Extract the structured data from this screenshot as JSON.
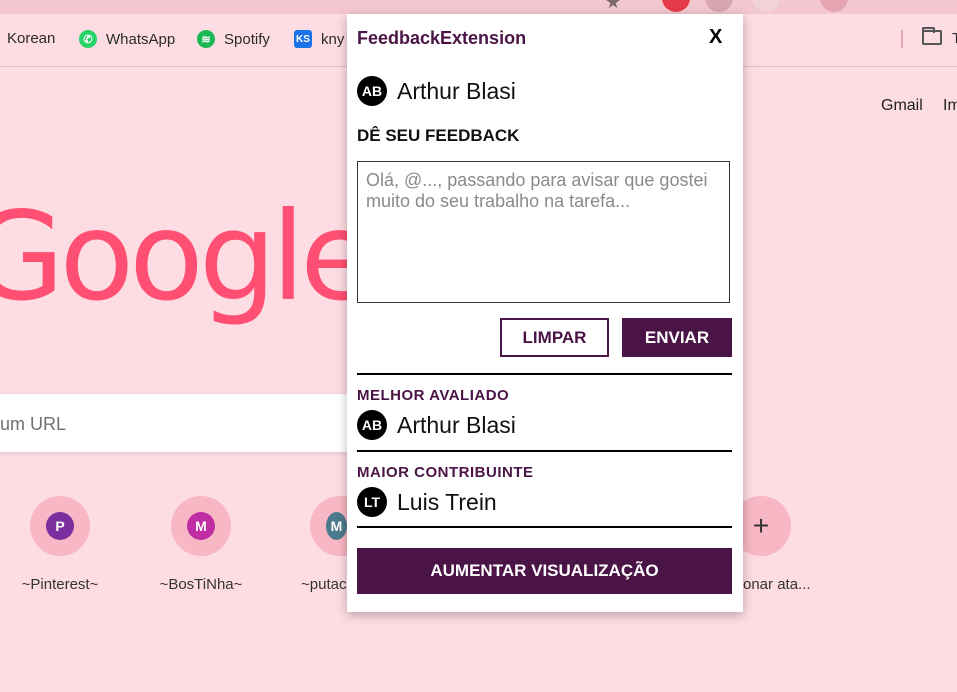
{
  "bookmarks": [
    {
      "label": "Korean",
      "icon": "korean-bookmark-icon"
    },
    {
      "label": "WhatsApp",
      "icon": "whatsapp-icon",
      "color": "#25d366"
    },
    {
      "label": "Spotify",
      "icon": "spotify-icon",
      "color": "#1db954"
    },
    {
      "label": "kny",
      "icon": "ks-icon",
      "color": "#1a73e8"
    }
  ],
  "bookmarks_right": {
    "folder_icon": "folder-icon",
    "truncated_label": "T"
  },
  "ntp": {
    "gmail_link": "Gmail",
    "images_link": "Im",
    "logo_text": "Google",
    "search_placeholder": "um URL",
    "shortcuts": [
      {
        "label": "~Pinterest~",
        "letter": "P",
        "color": "#7b2e9e"
      },
      {
        "label": "~BosTiNha~",
        "letter": "M",
        "color": "#c02ca2"
      },
      {
        "label": "~putac",
        "letter": "M",
        "color": "#4d7a8c"
      }
    ],
    "add_shortcut_label": "onar ata..."
  },
  "popup": {
    "title": "FeedbackExtension",
    "close_label": "X",
    "current_user": {
      "initials": "AB",
      "name": "Arthur Blasi"
    },
    "feedback_section_title": "DÊ SEU FEEDBACK",
    "feedback_placeholder": "Olá, @..., passando para avisar que gostei muito do seu trabalho na tarefa...",
    "clear_button": "LIMPAR",
    "send_button": "ENVIAR",
    "best_rated": {
      "title": "MELHOR AVALIADO",
      "initials": "AB",
      "name": "Arthur Blasi"
    },
    "top_contributor": {
      "title": "MAIOR CONTRIBUINTE",
      "initials": "LT",
      "name": "Luis Trein"
    },
    "expand_button": "AUMENTAR VISUALIZAÇÃO"
  },
  "colors": {
    "accent": "#4b1446",
    "page_bg": "#fddde3",
    "google_logo": "#ff5073"
  }
}
